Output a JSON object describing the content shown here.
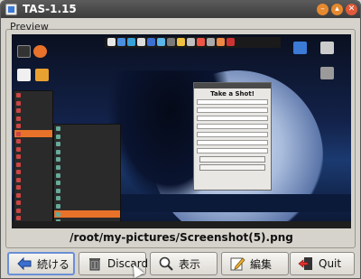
{
  "window": {
    "title": "TAS-1.15"
  },
  "preview": {
    "label": "Preview",
    "file_path": "/root/my-pictures/Screenshot(5).png"
  },
  "screenshot_content": {
    "dialog_title": "Take a Shot!"
  },
  "buttons": {
    "continue": "続ける",
    "discard": "Discard",
    "view": "表示",
    "edit": "編集",
    "quit": "Quit"
  },
  "colors": {
    "titlebar": "#3c3c3c",
    "accent_orange": "#e8722a",
    "close_red": "#e05a3a",
    "focus_border": "#6a8fd8"
  }
}
